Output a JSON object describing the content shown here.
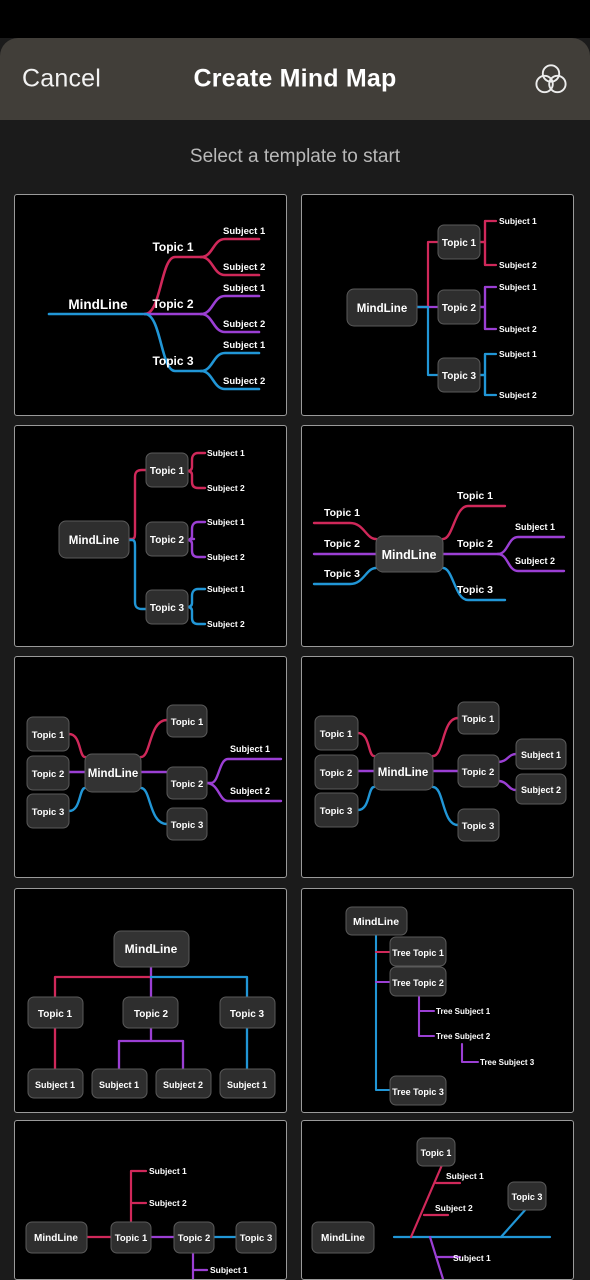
{
  "header": {
    "cancel_label": "Cancel",
    "title": "Create Mind Map",
    "theme_icon": "venn-circles-icon"
  },
  "subtitle": "Select a template to start",
  "colors": {
    "page_bg": "#1b1b1b",
    "sheet_bg": "#413e39",
    "card_bg": "#000000",
    "card_border": "#9a9a9a",
    "node_bg": "#2e2e2e",
    "node_border": "#5a5a5a",
    "node_text": "#ffffff",
    "branch_crimson": "#d0285a",
    "branch_purple": "#9b3fd4",
    "branch_blue": "#2196d6",
    "subtitle_text": "#b9b9b9"
  },
  "labels": {
    "root": "MindLine",
    "topic1": "Topic 1",
    "topic2": "Topic 2",
    "topic3": "Topic 3",
    "subject1": "Subject 1",
    "subject2": "Subject 2",
    "tree_topic1": "Tree Topic 1",
    "tree_topic2": "Tree Topic 2",
    "tree_topic3": "Tree Topic 3",
    "tree_subject1": "Tree Subject 1",
    "tree_subject2": "Tree Subject 2",
    "tree_subject3": "Tree Subject 3"
  },
  "templates": [
    {
      "index": 1,
      "name": "right-flow-curved",
      "root": "MindLine",
      "branches": [
        {
          "label": "Topic 1",
          "color": "#d0285a",
          "children": [
            "Subject 1",
            "Subject 2"
          ]
        },
        {
          "label": "Topic 2",
          "color": "#9b3fd4",
          "children": [
            "Subject 1",
            "Subject 2"
          ]
        },
        {
          "label": "Topic 3",
          "color": "#2196d6",
          "children": [
            "Subject 1",
            "Subject 2"
          ]
        }
      ]
    },
    {
      "index": 2,
      "name": "right-orthogonal-boxed",
      "root": "MindLine",
      "branches": [
        {
          "label": "Topic 1",
          "color": "#d0285a",
          "children": [
            "Subject 1",
            "Subject 2"
          ]
        },
        {
          "label": "Topic 2",
          "color": "#9b3fd4",
          "children": [
            "Subject 1",
            "Subject 2"
          ]
        },
        {
          "label": "Topic 3",
          "color": "#2196d6",
          "children": [
            "Subject 1",
            "Subject 2"
          ]
        }
      ]
    },
    {
      "index": 3,
      "name": "right-bracket-boxed",
      "root": "MindLine",
      "branches": [
        {
          "label": "Topic 1",
          "color": "#d0285a",
          "children": [
            "Subject 1",
            "Subject 2"
          ]
        },
        {
          "label": "Topic 2",
          "color": "#9b3fd4",
          "children": [
            "Subject 1",
            "Subject 2"
          ]
        },
        {
          "label": "Topic 3",
          "color": "#2196d6",
          "children": [
            "Subject 1",
            "Subject 2"
          ]
        }
      ]
    },
    {
      "index": 4,
      "name": "bidirectional-flow-curved",
      "root": "MindLine",
      "left_branches": [
        {
          "label": "Topic 1",
          "color": "#d0285a"
        },
        {
          "label": "Topic 2",
          "color": "#9b3fd4"
        },
        {
          "label": "Topic 3",
          "color": "#2196d6"
        }
      ],
      "right_branches": [
        {
          "label": "Topic 1",
          "color": "#d0285a",
          "children": []
        },
        {
          "label": "Topic 2",
          "color": "#9b3fd4",
          "children": [
            "Subject 1",
            "Subject 2"
          ]
        },
        {
          "label": "Topic 3",
          "color": "#2196d6",
          "children": []
        }
      ]
    },
    {
      "index": 5,
      "name": "bidirectional-boxed-topics",
      "root": "MindLine",
      "left_branches": [
        {
          "label": "Topic 1",
          "color": "#d0285a"
        },
        {
          "label": "Topic 2",
          "color": "#9b3fd4"
        },
        {
          "label": "Topic 3",
          "color": "#2196d6"
        }
      ],
      "right_branches": [
        {
          "label": "Topic 1",
          "color": "#d0285a",
          "children": []
        },
        {
          "label": "Topic 2",
          "color": "#9b3fd4",
          "children": [
            "Subject 1",
            "Subject 2"
          ]
        },
        {
          "label": "Topic 3",
          "color": "#2196d6",
          "children": []
        }
      ]
    },
    {
      "index": 6,
      "name": "bidirectional-all-boxed",
      "root": "MindLine",
      "left_branches": [
        {
          "label": "Topic 1",
          "color": "#d0285a"
        },
        {
          "label": "Topic 2",
          "color": "#9b3fd4"
        },
        {
          "label": "Topic 3",
          "color": "#2196d6"
        }
      ],
      "right_branches": [
        {
          "label": "Topic 1",
          "color": "#d0285a",
          "children": []
        },
        {
          "label": "Topic 2",
          "color": "#9b3fd4",
          "children": [
            "Subject 1",
            "Subject 2"
          ]
        },
        {
          "label": "Topic 3",
          "color": "#2196d6",
          "children": []
        }
      ]
    },
    {
      "index": 7,
      "name": "vertical-org-chart",
      "root": "MindLine",
      "branches": [
        {
          "label": "Topic 1",
          "color": "#d0285a",
          "children": [
            "Subject 1"
          ]
        },
        {
          "label": "Topic 2",
          "color": "#9b3fd4",
          "children": [
            "Subject 1",
            "Subject 2"
          ]
        },
        {
          "label": "Topic 3",
          "color": "#2196d6",
          "children": [
            "Subject 1"
          ]
        }
      ]
    },
    {
      "index": 8,
      "name": "tree-outline",
      "root": "MindLine",
      "branches": [
        {
          "label": "Tree Topic 1",
          "color": "#d0285a",
          "children": []
        },
        {
          "label": "Tree Topic 2",
          "color": "#9b3fd4",
          "children": [
            "Tree Subject 1",
            "Tree Subject 2",
            "Tree Subject 3"
          ]
        },
        {
          "label": "Tree Topic 3",
          "color": "#2196d6",
          "children": []
        }
      ]
    },
    {
      "index": 9,
      "name": "horizontal-timeline",
      "root": "MindLine",
      "chain": [
        {
          "label": "Topic 1",
          "color": "#d0285a",
          "children": [
            "Subject 1",
            "Subject 2"
          ]
        },
        {
          "label": "Topic 2",
          "color": "#9b3fd4",
          "children": [
            "Subject 1"
          ]
        },
        {
          "label": "Topic 3",
          "color": "#2196d6",
          "children": []
        }
      ]
    },
    {
      "index": 10,
      "name": "fishbone",
      "root": "MindLine",
      "bones": [
        {
          "label": "Topic 1",
          "color": "#d0285a",
          "children": [
            "Subject 1",
            "Subject 2"
          ]
        },
        {
          "label": "Topic 3",
          "color": "#2196d6",
          "children": []
        },
        {
          "label": "",
          "color": "#9b3fd4",
          "children": [
            "Subject 1"
          ]
        }
      ]
    }
  ]
}
